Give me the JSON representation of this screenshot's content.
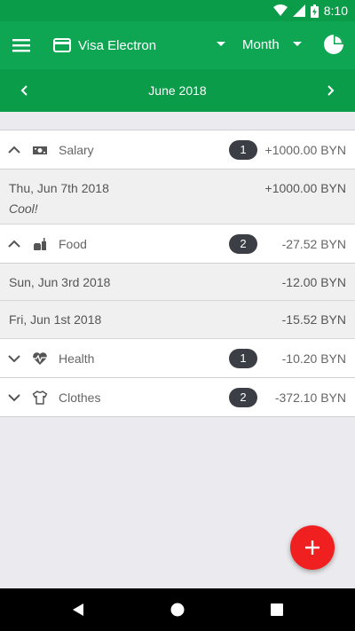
{
  "status_bar": {
    "time": "8:10"
  },
  "app_bar": {
    "card_name": "Visa Electron",
    "period": "Month"
  },
  "date_nav": {
    "title": "June 2018"
  },
  "categories": [
    {
      "name": "Salary",
      "count": "1",
      "amount": "+1000.00 BYN",
      "expanded": true,
      "icon": "money-icon",
      "transactions": [
        {
          "date": "Thu, Jun 7th 2018",
          "amount": "+1000.00 BYN",
          "note": "Cool!"
        }
      ]
    },
    {
      "name": "Food",
      "count": "2",
      "amount": "-27.52 BYN",
      "expanded": true,
      "icon": "food-icon",
      "transactions": [
        {
          "date": "Sun, Jun 3rd 2018",
          "amount": "-12.00 BYN"
        },
        {
          "date": "Fri, Jun 1st 2018",
          "amount": "-15.52 BYN"
        }
      ]
    },
    {
      "name": "Health",
      "count": "1",
      "amount": "-10.20 BYN",
      "expanded": false,
      "icon": "heartbeat-icon"
    },
    {
      "name": "Clothes",
      "count": "2",
      "amount": "-372.10 BYN",
      "expanded": false,
      "icon": "tshirt-icon"
    }
  ],
  "colors": {
    "primary": "#0ea553",
    "primary_dark": "#0b9c4a",
    "fab": "#f02020"
  }
}
